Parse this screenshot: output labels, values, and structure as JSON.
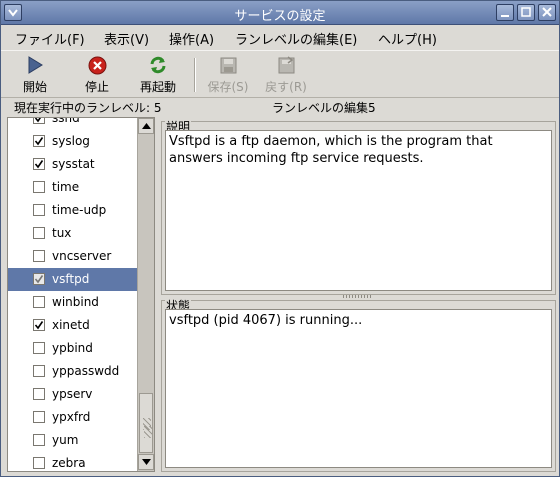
{
  "window": {
    "title": "サービスの設定"
  },
  "menubar": {
    "items": [
      {
        "label": "ファイル(F)"
      },
      {
        "label": "表示(V)"
      },
      {
        "label": "操作(A)"
      },
      {
        "label": "ランレベルの編集(E)"
      },
      {
        "label": "ヘルプ(H)"
      }
    ]
  },
  "toolbar": {
    "start_label": "開始",
    "stop_label": "停止",
    "restart_label": "再起動",
    "save_label": "保存(S)",
    "revert_label": "戻す(R)",
    "icons": [
      "play-icon",
      "stop-icon",
      "restart-icon",
      "save-icon",
      "revert-icon"
    ]
  },
  "status": {
    "current_runlevel": "現在実行中のランレベル: 5",
    "editing_runlevel": "ランレベルの編集5"
  },
  "services": [
    {
      "name": "sshd",
      "checked": true,
      "selected": false
    },
    {
      "name": "syslog",
      "checked": true,
      "selected": false
    },
    {
      "name": "sysstat",
      "checked": true,
      "selected": false
    },
    {
      "name": "time",
      "checked": false,
      "selected": false
    },
    {
      "name": "time-udp",
      "checked": false,
      "selected": false
    },
    {
      "name": "tux",
      "checked": false,
      "selected": false
    },
    {
      "name": "vncserver",
      "checked": false,
      "selected": false
    },
    {
      "name": "vsftpd",
      "checked": true,
      "selected": true
    },
    {
      "name": "winbind",
      "checked": false,
      "selected": false
    },
    {
      "name": "xinetd",
      "checked": true,
      "selected": false
    },
    {
      "name": "ypbind",
      "checked": false,
      "selected": false
    },
    {
      "name": "yppasswdd",
      "checked": false,
      "selected": false
    },
    {
      "name": "ypserv",
      "checked": false,
      "selected": false
    },
    {
      "name": "ypxfrd",
      "checked": false,
      "selected": false
    },
    {
      "name": "yum",
      "checked": false,
      "selected": false
    },
    {
      "name": "zebra",
      "checked": false,
      "selected": false
    }
  ],
  "description": {
    "heading": "説明",
    "text": "Vsftpd is a ftp daemon, which is the program that answers incoming ftp service requests."
  },
  "state": {
    "heading": "状態",
    "text": "vsftpd (pid 4067) is running..."
  },
  "colors": {
    "selection": "#5f78a8",
    "titlebar": "#6f86b4"
  }
}
